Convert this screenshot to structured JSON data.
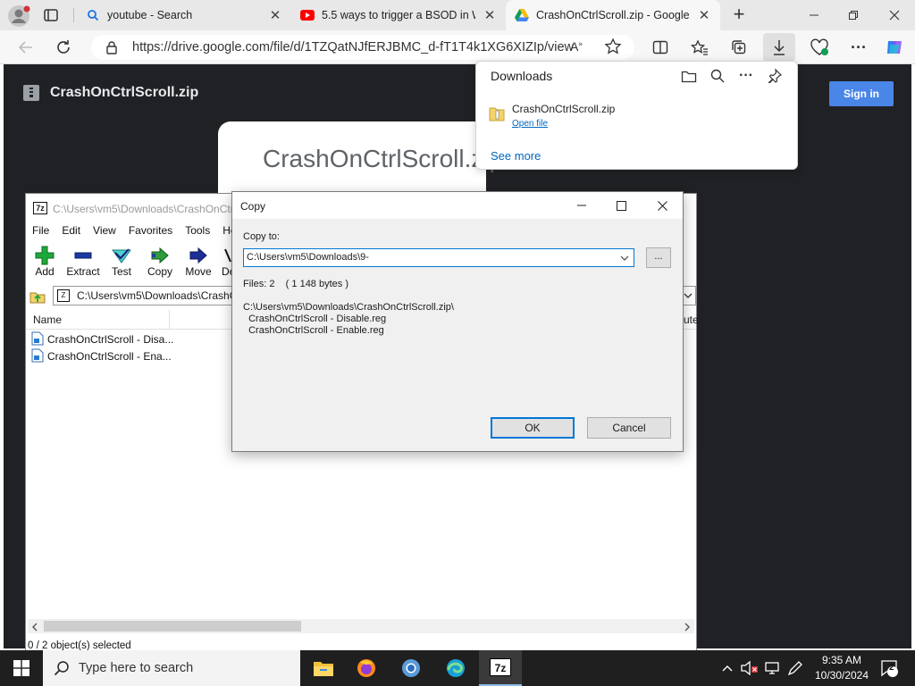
{
  "browser": {
    "tabs": [
      {
        "title": "youtube - Search",
        "icon": "search-icon"
      },
      {
        "title": "5.5 ways to trigger a BSOD in Wi",
        "icon": "youtube-icon"
      },
      {
        "title": "CrashOnCtrlScroll.zip - Google D",
        "icon": "google-drive-icon",
        "active": true
      }
    ],
    "url": "https://drive.google.com/file/d/1TZQatNJfERJBMC_d-fT1T4k1XG6XIZIp/view"
  },
  "drive": {
    "file_title": "CrashOnCtrlScroll.zip",
    "sign_in_label": "Sign in",
    "preview_title": "CrashOnCtrlScroll.zip"
  },
  "downloads": {
    "title": "Downloads",
    "file_name": "CrashOnCtrlScroll.zip",
    "open_file_label": "Open file",
    "see_more_label": "See more"
  },
  "sevenzip": {
    "title": "C:\\Users\\vm5\\Downloads\\CrashOnCtrlScroll.zip\\",
    "menu": [
      "File",
      "Edit",
      "View",
      "Favorites",
      "Tools",
      "Help"
    ],
    "toolbar": [
      "Add",
      "Extract",
      "Test",
      "Copy",
      "Move",
      "Delete"
    ],
    "path": "C:\\Users\\vm5\\Downloads\\CrashOnCtrlScroll.zip\\",
    "column_name": "Name",
    "files": [
      "CrashOnCtrlScroll - Disa...",
      "CrashOnCtrlScroll - Ena..."
    ],
    "status": "0 / 2 object(s) selected"
  },
  "copy_dialog": {
    "title": "Copy",
    "copy_to_label": "Copy to:",
    "destination": "C:\\Users\\vm5\\Downloads\\9-",
    "browse_label": "...",
    "files_info": "Files: 2    ( 1 148 bytes )",
    "source_lines": "C:\\Users\\vm5\\Downloads\\CrashOnCtrlScroll.zip\\\n  CrashOnCtrlScroll - Disable.reg\n  CrashOnCtrlScroll - Enable.reg",
    "ok_label": "OK",
    "cancel_label": "Cancel"
  },
  "taskbar": {
    "search_placeholder": "Type here to search",
    "time": "9:35 AM",
    "date": "10/30/2024",
    "notification_count": "2"
  }
}
